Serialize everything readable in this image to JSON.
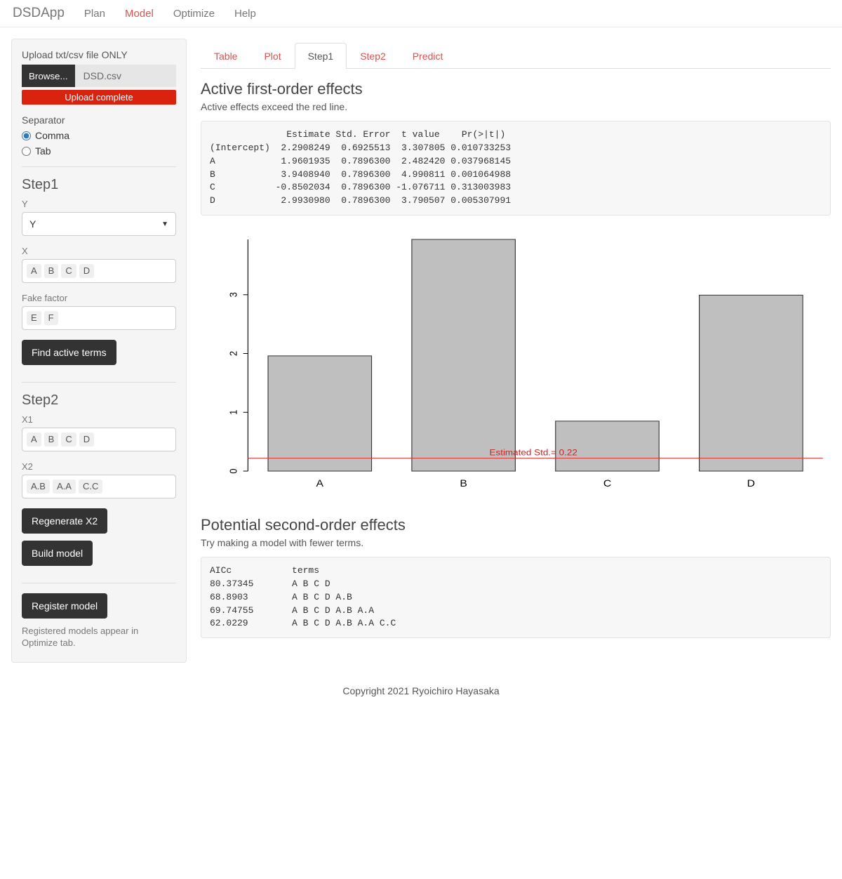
{
  "nav": {
    "brand": "DSDApp",
    "items": [
      "Plan",
      "Model",
      "Optimize",
      "Help"
    ],
    "active": "Model"
  },
  "sidebar": {
    "upload_label": "Upload txt/csv file ONLY",
    "browse": "Browse...",
    "file_name": "DSD.csv",
    "upload_status": "Upload complete",
    "separator_label": "Separator",
    "sep_options": {
      "comma": "Comma",
      "tab": "Tab"
    },
    "sep_selected": "Comma",
    "step1": {
      "heading": "Step1",
      "y_label": "Y",
      "y_value": "Y",
      "x_label": "X",
      "x_tags": [
        "A",
        "B",
        "C",
        "D"
      ],
      "fake_label": "Fake factor",
      "fake_tags": [
        "E",
        "F"
      ],
      "find_btn": "Find active terms"
    },
    "step2": {
      "heading": "Step2",
      "x1_label": "X1",
      "x1_tags": [
        "A",
        "B",
        "C",
        "D"
      ],
      "x2_label": "X2",
      "x2_tags": [
        "A.B",
        "A.A",
        "C.C"
      ],
      "regen_btn": "Regenerate X2",
      "build_btn": "Build model"
    },
    "register_btn": "Register model",
    "register_help": "Registered models appear in Optimize tab."
  },
  "tabs": {
    "items": [
      "Table",
      "Plot",
      "Step1",
      "Step2",
      "Predict"
    ],
    "active": "Step1"
  },
  "section1": {
    "title": "Active first-order effects",
    "sub": "Active effects exceed the red line.",
    "table_header": "              Estimate Std. Error  t value    Pr(>|t|)",
    "rows": [
      "(Intercept)  2.2908249  0.6925513  3.307805 0.010733253",
      "A            1.9601935  0.7896300  2.482420 0.037968145",
      "B            3.9408940  0.7896300  4.990811 0.001064988",
      "C           -0.8502034  0.7896300 -1.076711 0.313003983",
      "D            2.9930980  0.7896300  3.790507 0.005307991"
    ]
  },
  "chart_data": {
    "type": "bar",
    "categories": [
      "A",
      "B",
      "C",
      "D"
    ],
    "values": [
      1.96,
      3.941,
      0.85,
      2.993
    ],
    "threshold": 0.22,
    "threshold_label": "Estimated Std.=  0.22",
    "ylim": [
      0,
      3.941
    ],
    "yticks": [
      0,
      1,
      2,
      3
    ]
  },
  "section2": {
    "title": "Potential second-order effects",
    "sub": "Try making a model with fewer terms.",
    "header": "AICc           terms",
    "rows": [
      "80.37345       A B C D",
      "68.8903        A B C D A.B",
      "69.74755       A B C D A.B A.A",
      "62.0229        A B C D A.B A.A C.C"
    ]
  },
  "footer": "Copyright 2021 Ryoichiro Hayasaka"
}
